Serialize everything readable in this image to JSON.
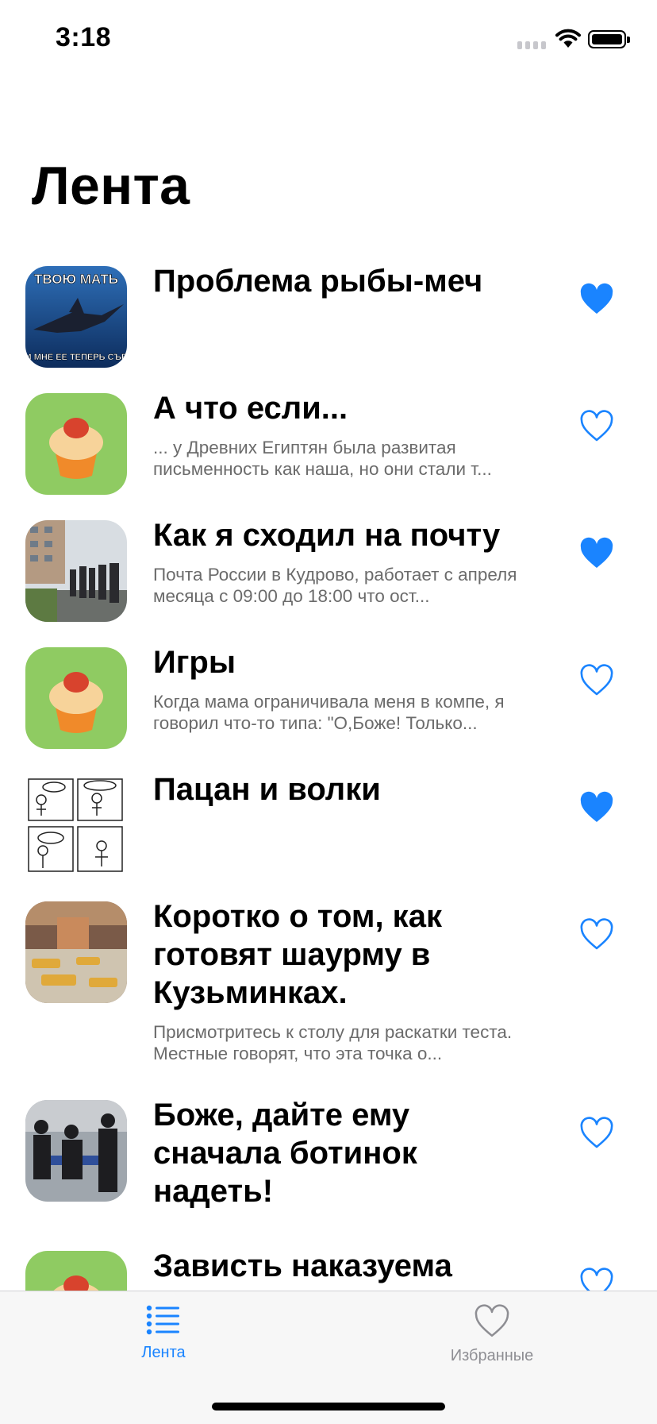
{
  "status_bar": {
    "time": "3:18"
  },
  "page": {
    "title": "Лента"
  },
  "colors": {
    "accent": "#1a84ff",
    "inactive": "#8e8e93"
  },
  "feed": [
    {
      "title": "Проблема рыбы-меч",
      "description": "",
      "favorite": true,
      "thumb": "swordfish-meme",
      "thumb_caption_top": "ТВОЮ МАТЬ",
      "thumb_caption_bottom": "И МНЕ ЕЕ ТЕПЕРЬ СЪЕ"
    },
    {
      "title": "А что если...",
      "description": "... у Древних Египтян была развитая письменность как наша, но они стали т...",
      "favorite": false,
      "thumb": "muffin-app-icon"
    },
    {
      "title": "Как я сходил на почту",
      "description": "Почта России в Кудрово, работает с апреля месяца с 09:00 до 18:00 что ост...",
      "favorite": true,
      "thumb": "post-office-queue-photo"
    },
    {
      "title": "Игры",
      "description": "Когда мама ограничивала меня в компе, я говорил что-то типа: \"О,Боже! Только...",
      "favorite": false,
      "thumb": "muffin-app-icon"
    },
    {
      "title": "Пацан и волки",
      "description": "",
      "favorite": true,
      "thumb": "comic-strip"
    },
    {
      "title": "Коротко о том, как готовят шаурму в Кузьминках.",
      "description": "Присмотритесь к столу для раскатки теста. Местные говорят, что эта точка о...",
      "favorite": false,
      "thumb": "food-stall-photo"
    },
    {
      "title": "Боже, дайте ему сначала ботинок надеть!",
      "description": "",
      "favorite": false,
      "thumb": "people-photo"
    },
    {
      "title": "Зависть наказуема",
      "description": "",
      "favorite": false,
      "thumb": "muffin-app-icon"
    }
  ],
  "tab_bar": {
    "tabs": [
      {
        "label": "Лента",
        "icon": "list-icon",
        "selected": true
      },
      {
        "label": "Избранные",
        "icon": "heart-outline-icon",
        "selected": false
      }
    ]
  }
}
